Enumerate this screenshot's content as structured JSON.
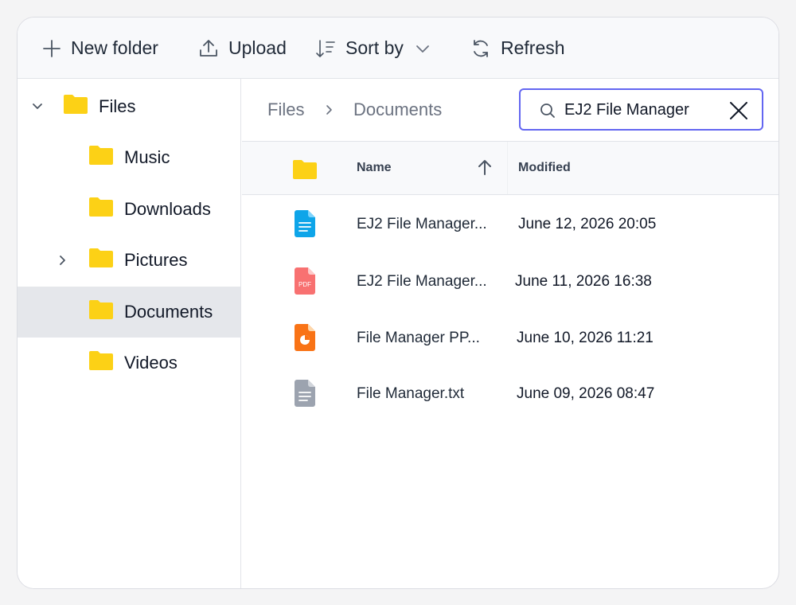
{
  "toolbar": {
    "new_folder": "New folder",
    "upload": "Upload",
    "sort_by": "Sort by",
    "refresh": "Refresh"
  },
  "tree": {
    "items": [
      {
        "label": "Files",
        "expanded": true,
        "icon": "folder-icon"
      },
      {
        "label": "Music",
        "icon": "folder-icon"
      },
      {
        "label": "Downloads",
        "icon": "folder-icon"
      },
      {
        "label": "Pictures",
        "collapsed": true,
        "icon": "folder-icon"
      },
      {
        "label": "Documents",
        "selected": true,
        "icon": "folder-icon"
      },
      {
        "label": "Videos",
        "icon": "folder-icon"
      }
    ]
  },
  "breadcrumb": {
    "items": [
      "Files",
      "Documents"
    ]
  },
  "search": {
    "value": "EJ2 File Manager"
  },
  "grid": {
    "columns": {
      "name": "Name",
      "modified": "Modified"
    },
    "sort": "ascending",
    "rows": [
      {
        "name": "EJ2 File Manager...",
        "modified": "June 12, 2026 20:05",
        "icon": "doc-file-icon"
      },
      {
        "name": "EJ2 File Manager...",
        "modified": "June 11, 2026 16:38",
        "icon": "pdf-file-icon",
        "icon_text": "PDF"
      },
      {
        "name": "File Manager PP...",
        "modified": "June 10, 2026 11:21",
        "icon": "ppt-file-icon"
      },
      {
        "name": "File Manager.txt",
        "modified": "June 09, 2026 08:47",
        "icon": "txt-file-icon"
      }
    ]
  },
  "colors": {
    "accent": "#6366f1",
    "folder": "#fcd116",
    "doc": "#0ea5e9",
    "pdf": "#f87171",
    "ppt": "#f97316",
    "txt": "#9ca3af",
    "selected_bg": "#e5e7eb"
  }
}
